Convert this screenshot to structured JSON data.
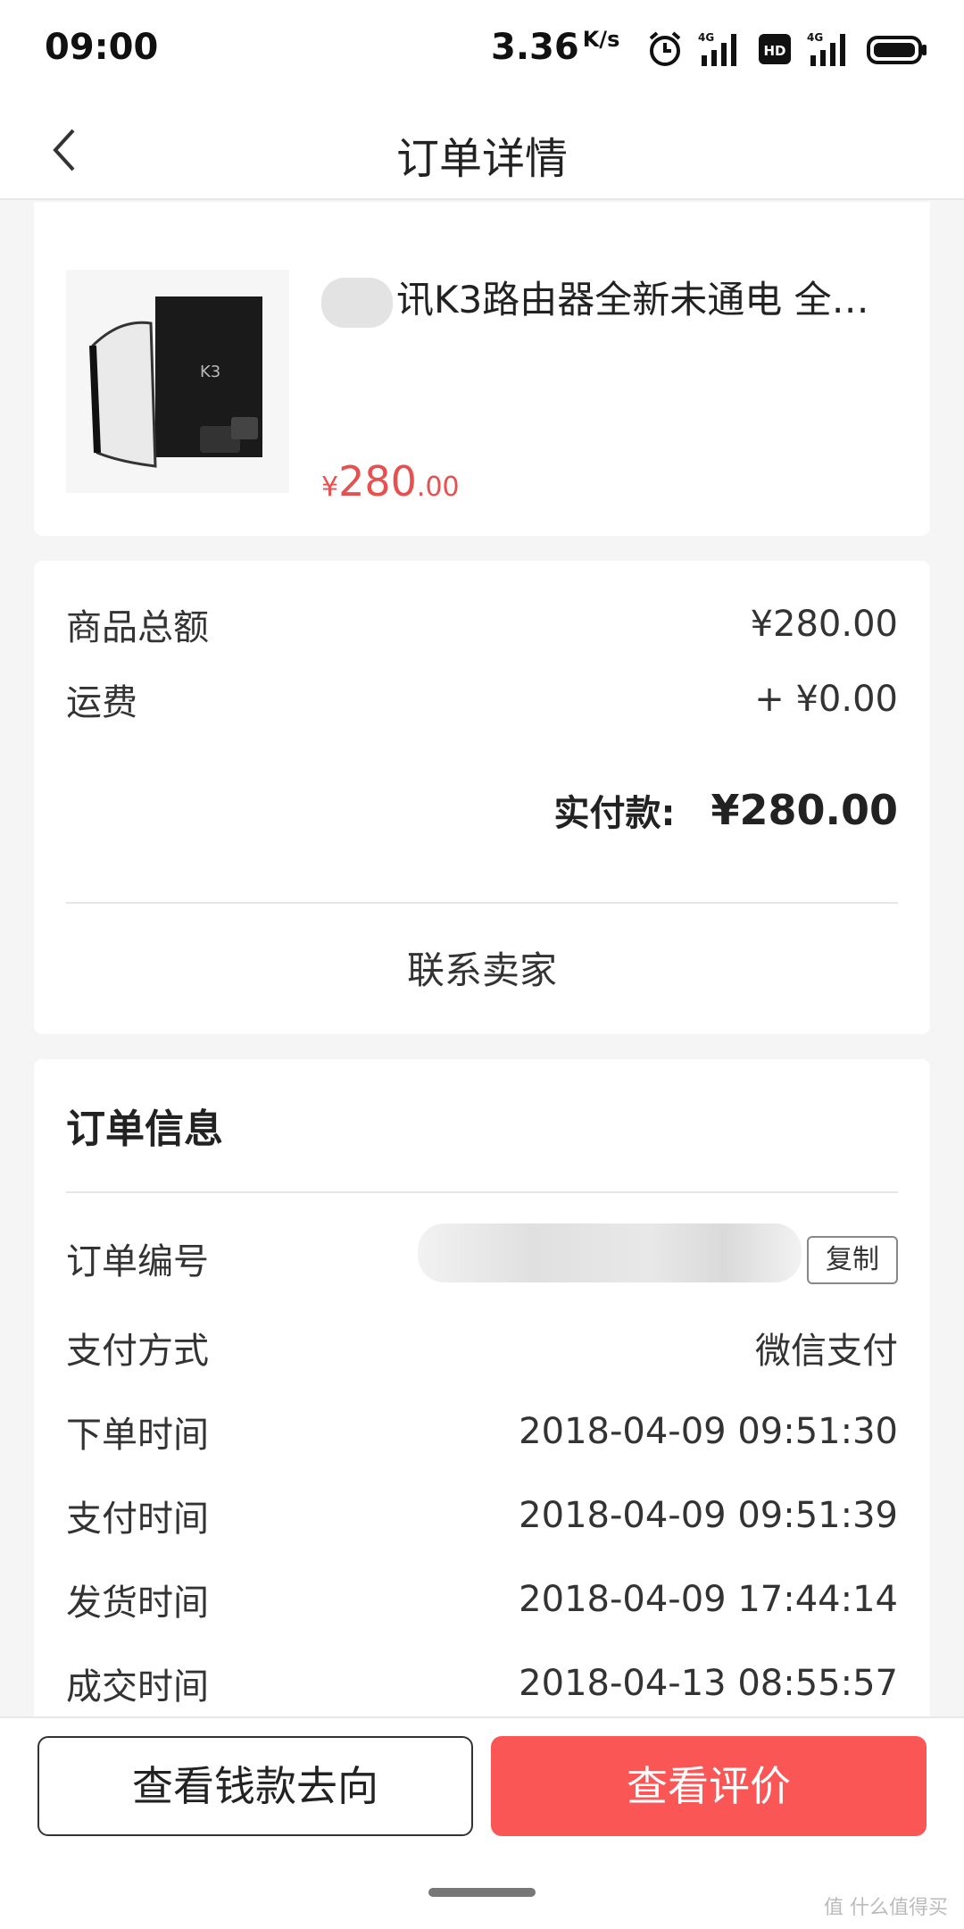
{
  "status_bar": {
    "time": "09:00",
    "speed_value": "3.36",
    "speed_unit": "K/s",
    "icons": [
      "alarm-icon",
      "signal-4g-icon",
      "hd-icon",
      "signal-4g-icon",
      "battery-icon"
    ],
    "signal_label": "4G",
    "hd_label": "HD"
  },
  "nav": {
    "title": "订单详情",
    "back_icon": "chevron-left-icon"
  },
  "product": {
    "title_visible": "讯K3路由器全新未通电 全新...",
    "image_label": "K3",
    "price_symbol": "¥",
    "price_int": "280",
    "price_dec": ".00",
    "price_color": "#e84f4f"
  },
  "amount": {
    "subtotal_label": "商品总额",
    "subtotal_value": "¥280.00",
    "shipping_label": "运费",
    "shipping_value": "+ ¥0.00",
    "paid_label": "实付款:",
    "paid_value": "¥280.00",
    "contact_seller": "联系卖家"
  },
  "order_info": {
    "heading": "订单信息",
    "rows": [
      {
        "label": "订单编号",
        "value": ""
      },
      {
        "label": "支付方式",
        "value": "微信支付"
      },
      {
        "label": "下单时间",
        "value": "2018-04-09 09:51:30"
      },
      {
        "label": "支付时间",
        "value": "2018-04-09 09:51:39"
      },
      {
        "label": "发货时间",
        "value": "2018-04-09 17:44:14"
      },
      {
        "label": "成交时间",
        "value": "2018-04-13 08:55:57"
      }
    ],
    "copy_label": "复制"
  },
  "bottom": {
    "money_flow_button": "查看钱款去向",
    "review_button": "查看评价",
    "primary_color": "#fa5656"
  },
  "watermark": "值 什么值得买"
}
